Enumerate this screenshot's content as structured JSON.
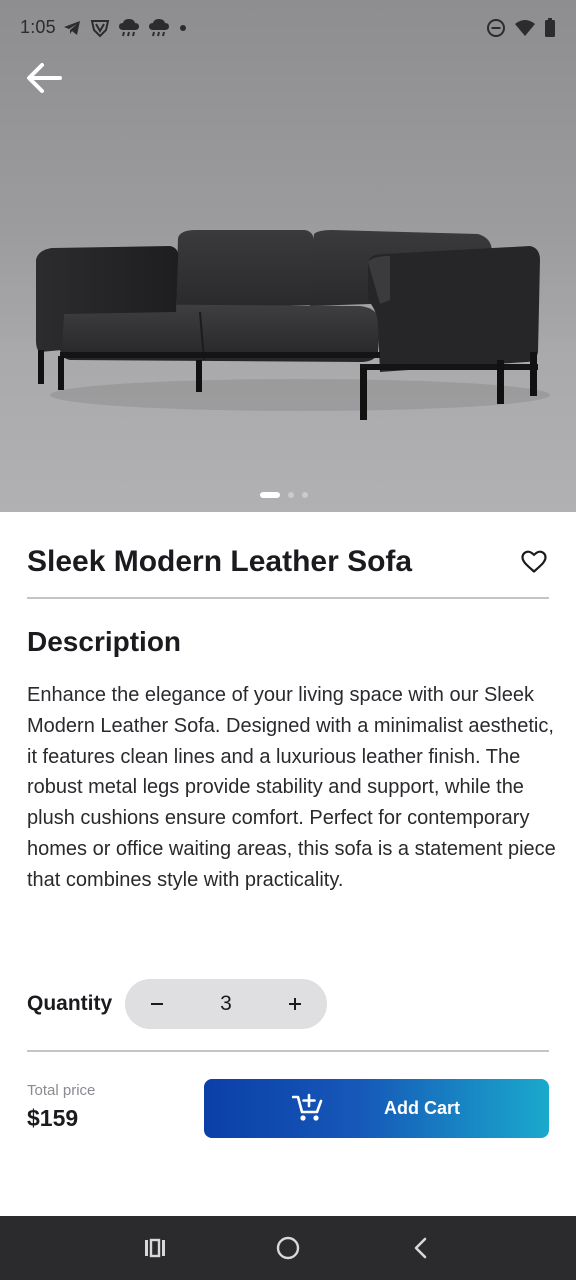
{
  "status_bar": {
    "time": "1:05",
    "left_icons": [
      "telegram-icon",
      "shield-v-icon",
      "cloud-rain-icon",
      "cloud-rain-icon",
      "dot-icon"
    ],
    "right_icons": [
      "do-not-disturb-icon",
      "wifi-icon",
      "battery-icon"
    ]
  },
  "hero": {
    "image": "sofa-photo",
    "carousel": {
      "count": 3,
      "active_index": 0
    }
  },
  "product": {
    "title": "Sleek Modern Leather Sofa",
    "favorite_icon": "heart-outline-icon"
  },
  "description": {
    "heading": "Description",
    "text": "Enhance the elegance of your living space with our Sleek Modern Leather Sofa. Designed with a minimalist aesthetic, it features clean lines and a luxurious leather finish. The robust metal legs provide stability and support, while the plush cushions ensure comfort. Perfect for contemporary homes or office waiting areas, this sofa is a statement piece that combines style with practicality."
  },
  "quantity": {
    "label": "Quantity",
    "value": "3",
    "decrement_icon": "minus-icon",
    "increment_icon": "plus-icon"
  },
  "price": {
    "label": "Total price",
    "value": "$159"
  },
  "add_cart": {
    "label": "Add Cart",
    "icon": "cart-add-icon"
  },
  "colors": {
    "button_start": "#0b3fa8",
    "button_end": "#1aa9cc",
    "stepper_bg": "#dfdfe2",
    "navbar_bg": "#2b2b2d"
  },
  "navbar": {
    "items": [
      "recents-icon",
      "home-icon",
      "back-icon"
    ]
  }
}
